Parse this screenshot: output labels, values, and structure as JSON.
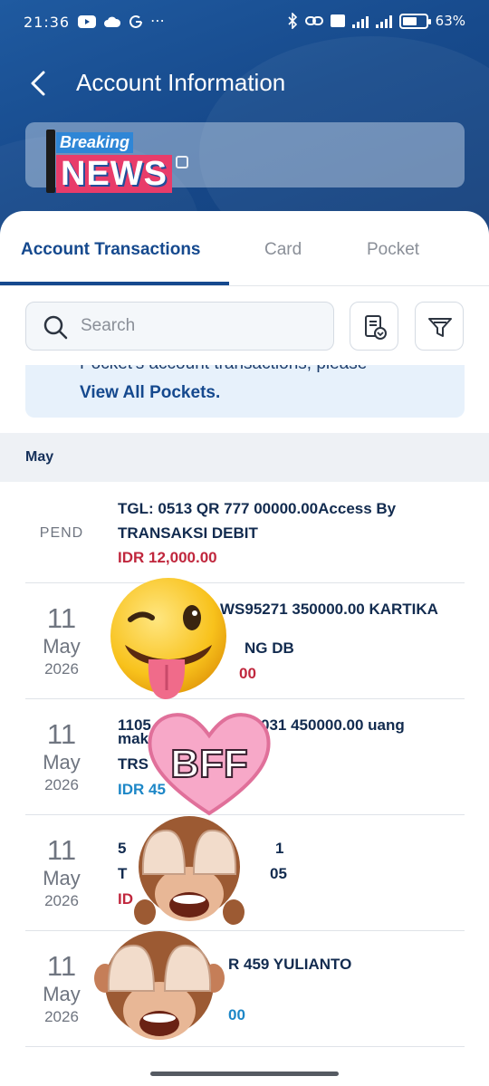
{
  "status_bar": {
    "time": "21:36",
    "battery_text": "63%",
    "battery_level": 0.63
  },
  "header": {
    "title": "Account Information"
  },
  "sticker_news": {
    "small": "Breaking",
    "big": "NEWS"
  },
  "tabs": [
    {
      "label": "Account Transactions",
      "active": true
    },
    {
      "label": "Card",
      "active": false
    },
    {
      "label": "Pocket",
      "active": false
    }
  ],
  "search": {
    "placeholder": "Search"
  },
  "info": {
    "text": "Pocket's account transactions, please",
    "link": "View All Pockets."
  },
  "month": "May",
  "transactions": [
    {
      "status": "PEND",
      "line1": "TGL: 0513 QR  777 00000.00Access By",
      "line2": "TRANSAKSI DEBIT",
      "amount": "IDR 12,000.00"
    },
    {
      "day": "11",
      "month": "May",
      "year": "2026",
      "line1": "WS95271 350000.00 KARTIKA",
      "line2": "NG DB",
      "amount": "00"
    },
    {
      "day": "11",
      "month": "May",
      "year": "2026",
      "line1": "1105",
      "line1b": "031 450000.00 uang",
      "line2": "mak",
      "line3": "TRS",
      "amount": "IDR 45"
    },
    {
      "day": "11",
      "month": "May",
      "year": "2026",
      "line1": "5",
      "line1b": "1",
      "line2": "T",
      "line2b": "05",
      "amount": "ID"
    },
    {
      "day": "11",
      "month": "May",
      "year": "2026",
      "line1": "R 459 YULIANTO",
      "amount": "00"
    }
  ],
  "sticker_bff": "BFF",
  "colors": {
    "primary": "#15498e",
    "header_bg": "#174a8c",
    "amount_debit": "#c0273d",
    "amount_credit": "#1d87c7"
  }
}
